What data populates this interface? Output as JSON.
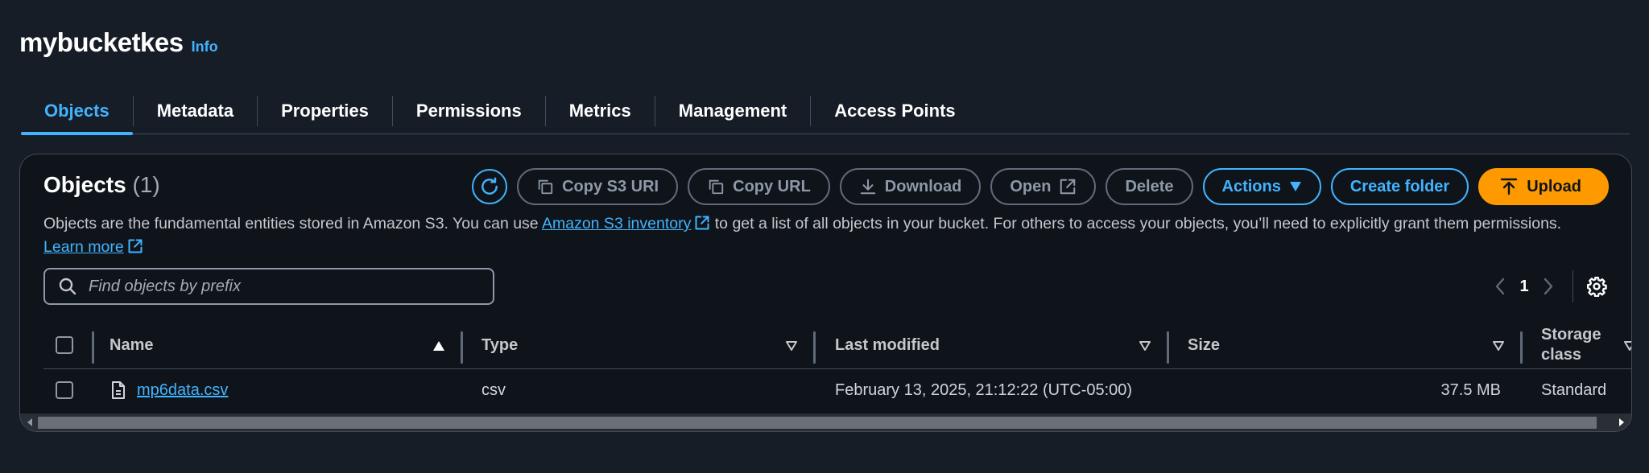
{
  "header": {
    "bucket_name": "mybucketkes",
    "info_label": "Info"
  },
  "tabs": [
    {
      "label": "Objects",
      "active": true
    },
    {
      "label": "Metadata"
    },
    {
      "label": "Properties"
    },
    {
      "label": "Permissions"
    },
    {
      "label": "Metrics"
    },
    {
      "label": "Management"
    },
    {
      "label": "Access Points"
    }
  ],
  "objects_panel": {
    "title": "Objects",
    "count": "(1)",
    "toolbar": {
      "refresh_icon": "refresh-icon",
      "copy_s3_uri": "Copy S3 URI",
      "copy_url": "Copy URL",
      "download": "Download",
      "open": "Open",
      "delete": "Delete",
      "actions": "Actions",
      "create_folder": "Create folder",
      "upload": "Upload"
    },
    "description": {
      "part1": "Objects are the fundamental entities stored in Amazon S3. You can use ",
      "inventory_link": "Amazon S3 inventory",
      "part2": " to get a list of all objects in your bucket. For others to access your objects, you’ll need to explicitly grant them permissions. ",
      "learn_more": "Learn more"
    },
    "search": {
      "placeholder": "Find objects by prefix",
      "value": ""
    },
    "pagination": {
      "current_page": "1"
    },
    "table": {
      "columns": [
        "Name",
        "Type",
        "Last modified",
        "Size",
        "Storage class"
      ],
      "rows": [
        {
          "name": "mp6data.csv",
          "type": "csv",
          "last_modified": "February 13, 2025, 21:12:22 (UTC-05:00)",
          "size": "37.5 MB",
          "storage_class": "Standard"
        }
      ]
    }
  },
  "colors": {
    "background": "#161d26",
    "panel": "#0f141a",
    "accent": "#42b4ff",
    "upload": "#ff9900",
    "border": "#414d5c"
  }
}
